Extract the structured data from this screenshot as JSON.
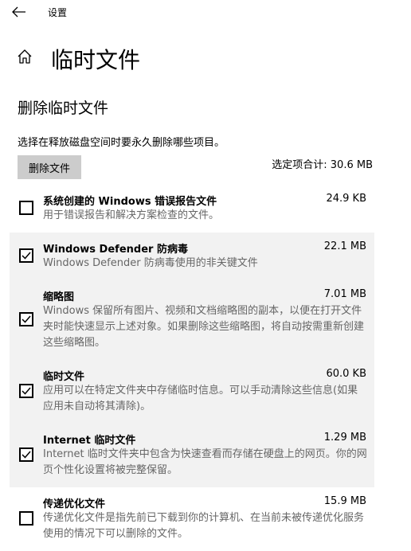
{
  "window": {
    "title": "设置"
  },
  "header": {
    "title": "临时文件"
  },
  "section": {
    "title": "删除临时文件",
    "description": "选择在释放磁盘空间时要永久删除哪些项目。",
    "delete_button_label": "删除文件",
    "total_label": "选定项合计: 30.6 MB"
  },
  "items": [
    {
      "name": "系统创建的 Windows 错误报告文件",
      "size": "24.9 KB",
      "description": "用于错误报告和解决方案检查的文件。",
      "checked": false
    },
    {
      "name": "Windows Defender 防病毒",
      "size": "22.1 MB",
      "description": "Windows Defender 防病毒使用的非关键文件",
      "checked": true
    },
    {
      "name": "缩略图",
      "size": "7.01 MB",
      "description": "Windows 保留所有图片、视频和文档缩略图的副本，以便在打开文件夹时能快速显示上述对象。如果删除这些缩略图，将自动按需重新创建这些缩略图。",
      "checked": true
    },
    {
      "name": "临时文件",
      "size": "60.0 KB",
      "description": "应用可以在特定文件夹中存储临时信息。可以手动清除这些信息(如果应用未自动将其清除)。",
      "checked": true
    },
    {
      "name": "Internet 临时文件",
      "size": "1.29 MB",
      "description": "Internet 临时文件夹中包含为快速查看而存储在硬盘上的网页。你的网页个性化设置将被完整保留。",
      "checked": true
    },
    {
      "name": "传递优化文件",
      "size": "15.9 MB",
      "description": "传递优化文件是指先前已下载到你的计算机、在当前未被传递优化服务使用的情况下可以删除的文件。",
      "checked": false
    }
  ]
}
